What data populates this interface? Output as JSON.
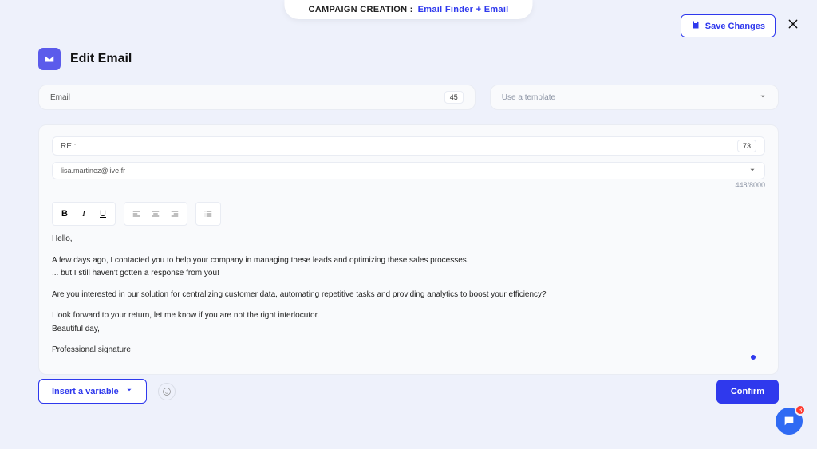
{
  "header": {
    "campaign_label": "CAMPAIGN CREATION :",
    "campaign_name": "Email Finder + Email",
    "save_label": "Save Changes",
    "page_title": "Edit Email"
  },
  "row1": {
    "email_label": "Email",
    "email_badge": "45",
    "template_placeholder": "Use a template"
  },
  "subject": {
    "prefix": "RE :",
    "badge": "73"
  },
  "from": {
    "address": "lisa.martinez@live.fr"
  },
  "counter": "448/8000",
  "body": {
    "l1": "Hello,",
    "l2": "A few days ago, I contacted you to help your company in managing these leads and optimizing these sales processes.",
    "l3": "... but I still haven't gotten a response from you!",
    "l4": "Are you interested in our solution for centralizing customer data, automating repetitive tasks and providing analytics to boost your efficiency?",
    "l5": "I look forward to your return, let me know if you are not the right interlocutor.",
    "l6": "Beautiful day,",
    "l7": "Professional signature"
  },
  "toolbar": {
    "bold": "B",
    "italic": "I",
    "underline": "U"
  },
  "footer": {
    "insert_variable": "Insert a variable",
    "confirm": "Confirm"
  },
  "fab": {
    "count": "3"
  },
  "colors": {
    "accent": "#2f39ed"
  }
}
